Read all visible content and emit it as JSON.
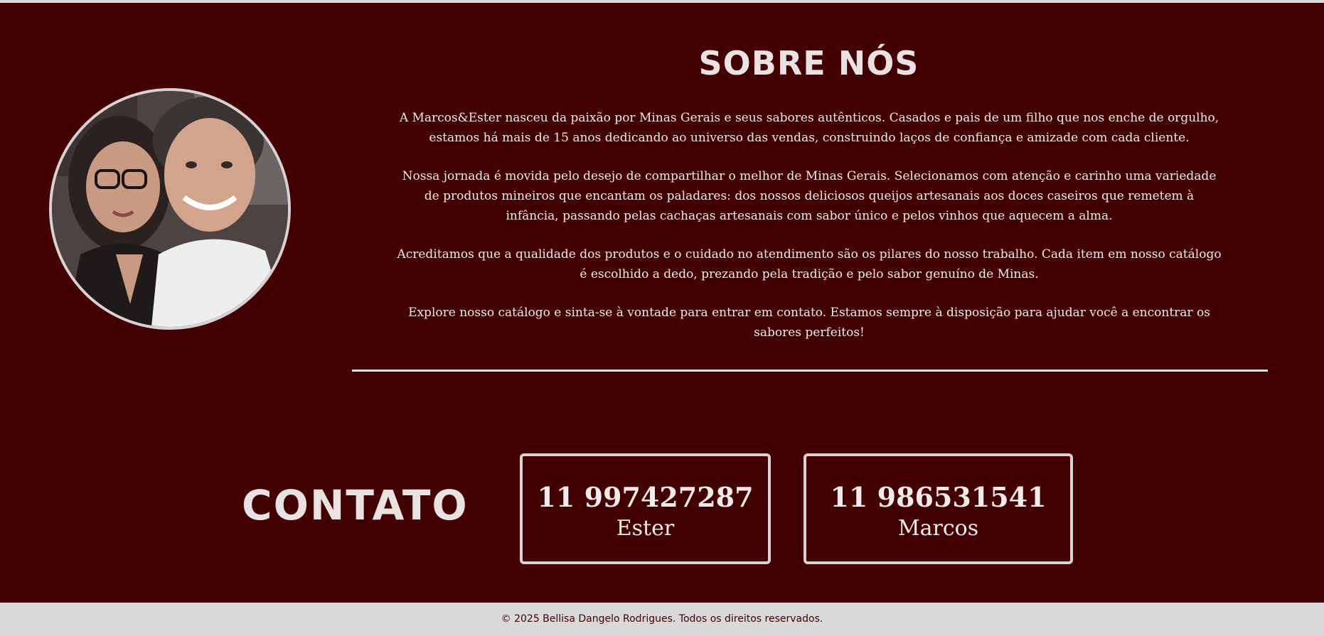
{
  "colors": {
    "background": "#430000",
    "text": "#f1eaea",
    "accent_border": "#d8d2d2",
    "footer_bg": "#d9d9d9",
    "footer_text": "#430000"
  },
  "about": {
    "title": "SOBRE NÓS",
    "paragraphs": [
      "A Marcos&Ester nasceu da paixão por Minas Gerais e seus sabores autênticos. Casados e pais de um filho que nos enche de orgulho, estamos há mais de 15 anos dedicando ao universo das vendas, construindo laços de confiança e amizade com cada cliente.",
      "Nossa jornada é movida pelo desejo de compartilhar o melhor de Minas Gerais. Selecionamos com atenção e carinho uma variedade de produtos mineiros que encantam os paladares: dos nossos deliciosos queijos artesanais aos doces caseiros que remetem à infância, passando pelas cachaças artesanais com sabor único e pelos vinhos que aquecem a alma.",
      "Acreditamos que a qualidade dos produtos e o cuidado no atendimento são os pilares do nosso trabalho. Cada item em nosso catálogo é escolhido a dedo, prezando pela tradição e pelo sabor genuíno de Minas.",
      "Explore nosso catálogo e sinta-se à vontade para entrar em contato. Estamos sempre à disposição para ajudar você a encontrar os sabores perfeitos!"
    ]
  },
  "contact": {
    "title": "CONTATO",
    "cards": [
      {
        "phone": "11 997427287",
        "name": "Ester"
      },
      {
        "phone": "11 986531541",
        "name": "Marcos"
      }
    ]
  },
  "footer": {
    "text": "© 2025 Bellisa Dangelo Rodrigues. Todos os direitos reservados."
  }
}
